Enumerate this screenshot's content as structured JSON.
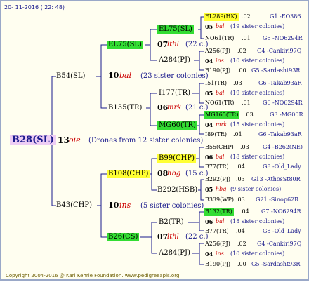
{
  "header": {
    "date": "20- 11-2016 ( 22: 48)"
  },
  "root": {
    "name": "B28(SL)",
    "gen": "13",
    "race": "oie",
    "note": "(Drones from 12 sister colonies)"
  },
  "mother_side": {
    "name": "B54(SL)",
    "gen": "10",
    "race": "bal",
    "note": "(23 sister colonies)",
    "qm": {
      "name": "EL75(SL)",
      "gen": "07",
      "race": "lthl",
      "note": "(22 c.)",
      "q": "EL289(HK)",
      "q_val": ".02",
      "q_gen": "G1 -EO386",
      "mid_gen": "05",
      "mid_race": "bal",
      "mid_note": "(19 sister colonies)",
      "d": "NO61(TR)",
      "d_val": ".01",
      "d_gen": "G6 -NO6294R"
    },
    "qm2": {
      "name": "A284(PJ)",
      "q": "A256(PJ)",
      "q_val": ".02",
      "q_gen": "G4 -Cankiri97Q",
      "mid_gen": "04",
      "mid_race": "ins",
      "mid_note": "(10 sister colonies)",
      "d": "B190(PJ)",
      "d_val": ".00",
      "d_gen": "G5 -Sardasht93R"
    },
    "dp": {
      "name": "B135(TR)",
      "gen": "06",
      "race": "mrk",
      "note": "(21 c.)",
      "top": "I177(TR)",
      "q": "I51(TR)",
      "q_val": ".03",
      "q_gen": "G6 -Takab93aR",
      "mid_gen": "05",
      "mid_race": "bal",
      "mid_note": "(19 sister colonies)",
      "d": "NO61(TR)",
      "d_val": ".01",
      "d_gen": "G6 -NO6294R",
      "bot": "MG60(TR)",
      "q2": "MG165(TR)",
      "q2_val": ".03",
      "q2_gen": "G3 -MG00R",
      "mid2_gen": "04",
      "mid2_race": "mrk",
      "mid2_note": "(15 sister colonies)",
      "d2": "I89(TR)",
      "d2_val": ".01",
      "d2_gen": "G6 -Takab93aR"
    }
  },
  "father_side": {
    "name": "B43(CHP)",
    "gen": "10",
    "race": "ins",
    "note": "(5 sister colonies)",
    "top": {
      "name": "B108(CHP)",
      "gen": "08",
      "race": "hbg",
      "note": "(15 c.)",
      "q_box": "B99(CHP)",
      "q": "B55(CHP)",
      "q_val": ".03",
      "q_gen": "G4 -B262(NE)",
      "mid_gen": "06",
      "mid_race": "bal",
      "mid_note": "(18 sister colonies)",
      "d": "B77(TR)",
      "d_val": ".04",
      "d_gen": "G8 -Old_Lady",
      "low": "B292(HSB)",
      "q2": "B292(PJ)",
      "q2_val": ".03",
      "q2_gen": "G13 -AthosSt80R",
      "mid2_gen": "05",
      "mid2_race": "hbg",
      "mid2_note": "(9 sister colonies)",
      "d2": "B339(WP)",
      "d2_val": ".03",
      "d2_gen": "G21 -Sinop62R"
    },
    "bottom": {
      "name": "B26(CS)",
      "gen": "07",
      "race": "lthl",
      "note": "(22 c.)",
      "top": "B2(TR)",
      "q": "B132(TR)",
      "q_val": ".04",
      "q_gen": "G7 -NO6294R",
      "mid_gen": "06",
      "mid_race": "bal",
      "mid_note": "(18 sister colonies)",
      "d": "B77(TR)",
      "d_val": ".04",
      "d_gen": "G8 -Old_Lady",
      "low": "A284(PJ)",
      "q2": "A256(PJ)",
      "q2_val": ".02",
      "q2_gen": "G4 -Cankiri97Q",
      "mid2_gen": "04",
      "mid2_race": "ins",
      "mid2_note": "(10 sister colonies)",
      "d2": "B190(PJ)",
      "d2_val": ".00",
      "d2_gen": "G5 -Sardasht93R"
    }
  },
  "footer": {
    "text": "Copyright 2004-2016 @ Karl Kehrle Foundation.    www.pedigreeapis.org"
  },
  "colors": {
    "line": "#1a1a8c",
    "green": "#33dd33",
    "yellow": "#ffff33",
    "purple": "#eecdf4"
  }
}
